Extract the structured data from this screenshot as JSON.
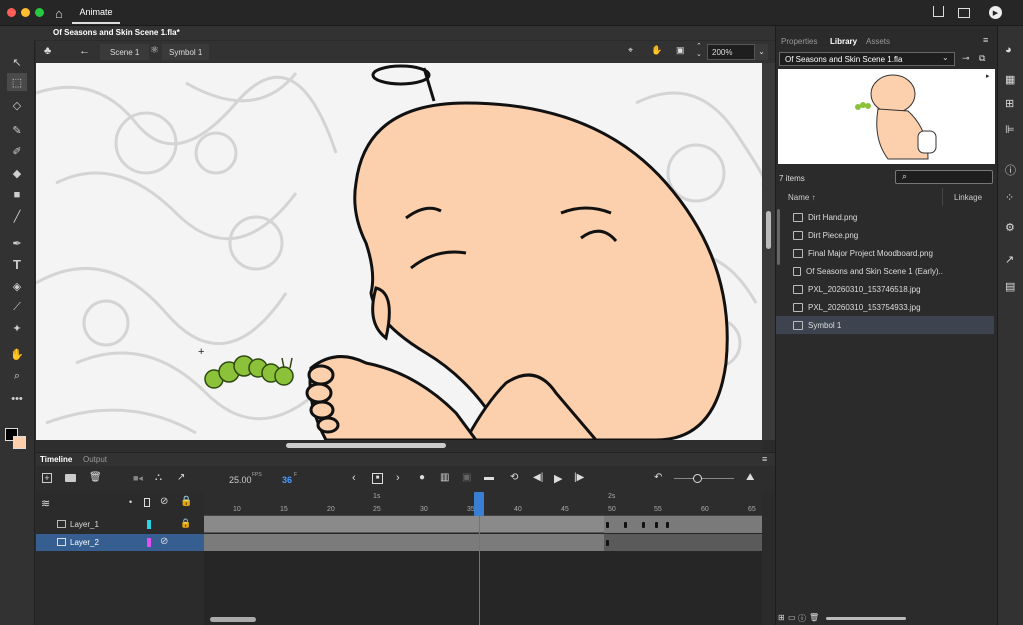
{
  "topbar": {
    "app_tab": "Animate"
  },
  "doc": {
    "tab": "Of Seasons and Skin Scene 1.fla*"
  },
  "edit": {
    "scene": "Scene 1",
    "symbol": "Symbol 1",
    "zoom": "200%"
  },
  "timeline": {
    "tab_timeline": "Timeline",
    "tab_output": "Output",
    "fps": "25.00",
    "fps_unit": "FPS",
    "frame": "36",
    "frame_unit": "F",
    "sec1": "1s",
    "sec2": "2s",
    "ticks": [
      "10",
      "15",
      "20",
      "25",
      "30",
      "35",
      "40",
      "45",
      "50",
      "55",
      "60",
      "65"
    ],
    "layers": [
      {
        "name": "Layer_1"
      },
      {
        "name": "Layer_2"
      }
    ]
  },
  "library": {
    "tab_properties": "Properties",
    "tab_library": "Library",
    "tab_assets": "Assets",
    "doc_select": "Of Seasons and Skin Scene 1.fla",
    "count": "7 items",
    "col_name": "Name",
    "col_linkage": "Linkage",
    "items": [
      "Dirt Hand.png",
      "Dirt Piece.png",
      "Final Major Project Moodboard.png",
      "Of Seasons and Skin Scene 1 (Early)..",
      "PXL_20260310_153746518.jpg",
      "PXL_20260310_153754933.jpg",
      "Symbol 1"
    ]
  },
  "colors": {
    "layer1": "#2ad4e6",
    "layer2": "#e24ff0",
    "playhead": "#3b7fd4",
    "skin": "#fdd0ad",
    "caterpillar": "#8bc23a"
  }
}
